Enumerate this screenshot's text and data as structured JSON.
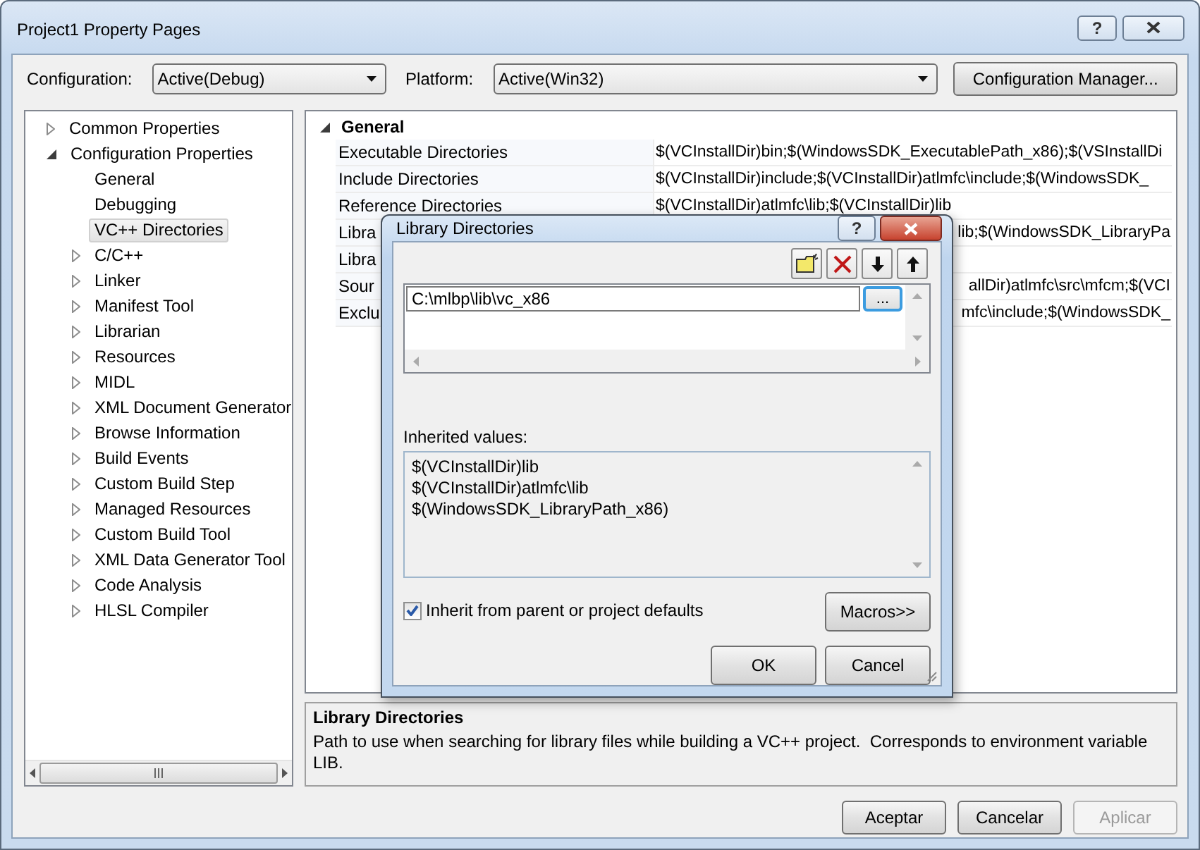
{
  "window": {
    "title": "Project1 Property Pages",
    "help_button": "?"
  },
  "config_bar": {
    "configuration_label": "Configuration:",
    "configuration": "Active(Debug)",
    "platform_label": "Platform:",
    "platform": "Active(Win32)",
    "manager_button": "Configuration Manager..."
  },
  "tree": [
    {
      "label": "Common Properties",
      "kind": "node",
      "expanded": false,
      "selected": false
    },
    {
      "label": "Configuration Properties",
      "kind": "node",
      "expanded": true,
      "selected": false,
      "children": [
        {
          "label": "General",
          "kind": "leaf",
          "selected": false
        },
        {
          "label": "Debugging",
          "kind": "leaf",
          "selected": false
        },
        {
          "label": "VC++ Directories",
          "kind": "leaf",
          "selected": true
        },
        {
          "label": "C/C++",
          "kind": "node",
          "expanded": false,
          "selected": false
        },
        {
          "label": "Linker",
          "kind": "node",
          "expanded": false,
          "selected": false
        },
        {
          "label": "Manifest Tool",
          "kind": "node",
          "expanded": false,
          "selected": false
        },
        {
          "label": "Librarian",
          "kind": "node",
          "expanded": false,
          "selected": false
        },
        {
          "label": "Resources",
          "kind": "node",
          "expanded": false,
          "selected": false
        },
        {
          "label": "MIDL",
          "kind": "node",
          "expanded": false,
          "selected": false
        },
        {
          "label": "XML Document Generator",
          "kind": "node",
          "expanded": false,
          "selected": false
        },
        {
          "label": "Browse Information",
          "kind": "node",
          "expanded": false,
          "selected": false
        },
        {
          "label": "Build Events",
          "kind": "node",
          "expanded": false,
          "selected": false
        },
        {
          "label": "Custom Build Step",
          "kind": "node",
          "expanded": false,
          "selected": false
        },
        {
          "label": "Managed Resources",
          "kind": "node",
          "expanded": false,
          "selected": false
        },
        {
          "label": "Custom Build Tool",
          "kind": "node",
          "expanded": false,
          "selected": false
        },
        {
          "label": "XML Data Generator Tool",
          "kind": "node",
          "expanded": false,
          "selected": false
        },
        {
          "label": "Code Analysis",
          "kind": "node",
          "expanded": false,
          "selected": false
        },
        {
          "label": "HLSL Compiler",
          "kind": "node",
          "expanded": false,
          "selected": false
        }
      ]
    }
  ],
  "grid": {
    "section": "General",
    "expanded": true,
    "rows": [
      {
        "name": "Executable Directories",
        "value": "$(VCInstallDir)bin;$(WindowsSDK_ExecutablePath_x86);$(VSInstallDi"
      },
      {
        "name": "Include Directories",
        "value": "$(VCInstallDir)include;$(VCInstallDir)atlmfc\\include;$(WindowsSDK_"
      },
      {
        "name": "Reference Directories",
        "value": "$(VCInstallDir)atlmfc\\lib;$(VCInstallDir)lib"
      },
      {
        "name": "Libra",
        "value": "lib;$(WindowsSDK_LibraryPa"
      },
      {
        "name": "Libra",
        "value": ""
      },
      {
        "name": "Sour",
        "value": "allDir)atlmfc\\src\\mfcm;$(VCI"
      },
      {
        "name": "Exclu",
        "value": "mfc\\include;$(WindowsSDK_"
      }
    ]
  },
  "description": {
    "title": "Library Directories",
    "text": "Path to use when searching for library files while building a VC++ project.  Corresponds to environment variable LIB."
  },
  "buttons": [
    {
      "label": "Aceptar",
      "disabled": false
    },
    {
      "label": "Cancelar",
      "disabled": false
    },
    {
      "label": "Aplicar",
      "disabled": true
    }
  ],
  "dialog": {
    "title": "Library Directories",
    "help_button": "?",
    "entry": "C:\\mlbp\\lib\\vc_x86",
    "browse_button": "...",
    "inherited_label": "Inherited values:",
    "inherited": [
      "$(VCInstallDir)lib",
      "$(VCInstallDir)atlmfc\\lib",
      "$(WindowsSDK_LibraryPath_x86)"
    ],
    "inherit_checkbox": {
      "label": "Inherit from parent or project defaults",
      "checked": true
    },
    "macros_button": "Macros>>",
    "buttons": [
      "OK",
      "Cancel"
    ]
  }
}
